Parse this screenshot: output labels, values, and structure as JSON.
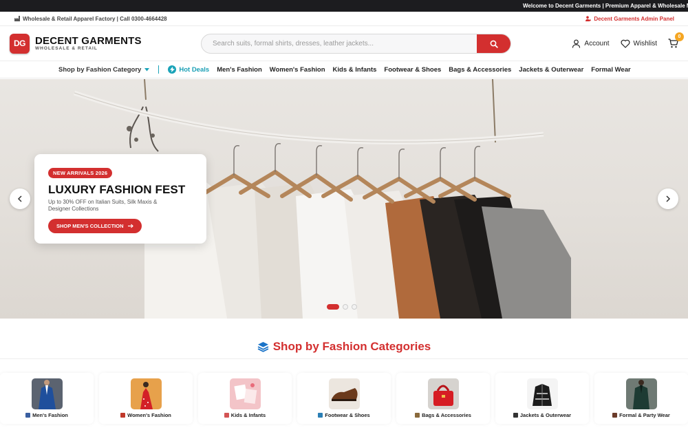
{
  "ticker": {
    "text": "Welcome to Decent Garments | Premium Apparel & Wholesale Ma"
  },
  "infobar": {
    "left_text": "Wholesale & Retail Apparel Factory | Call 0300-4664428",
    "right_text": "Decent Garments Admin Panel"
  },
  "header": {
    "logo_mark": "DG",
    "brand": "DECENT GARMENTS",
    "tagline": "WHOLESALE & RETAIL",
    "search_placeholder": "Search suits, formal shirts, dresses, leather jackets...",
    "account_label": "Account",
    "wishlist_label": "Wishlist",
    "cart_count": "0"
  },
  "nav": {
    "category_dropdown": "Shop by Fashion Category",
    "hot_deals": "Hot Deals",
    "items": [
      "Men's Fashion",
      "Women's Fashion",
      "Kids & Infants",
      "Footwear & Shoes",
      "Bags & Accessories",
      "Jackets & Outerwear",
      "Formal Wear"
    ]
  },
  "hero": {
    "badge": "NEW ARRIVALS 2026",
    "title": "LUXURY FASHION FEST",
    "description": "Up to 30% OFF on Italian Suits, Silk Maxis & Designer Collections",
    "cta": "SHOP MEN'S COLLECTION",
    "slide_count": 3,
    "active_slide": 1
  },
  "section": {
    "title": "Shop by Fashion Categories"
  },
  "categories": [
    {
      "label": "Men's Fashion",
      "icon": "shirt-icon",
      "color": "#3a5fa0"
    },
    {
      "label": "Women's Fashion",
      "icon": "dress-icon",
      "color": "#c0392b"
    },
    {
      "label": "Kids & Infants",
      "icon": "baby-icon",
      "color": "#d35454"
    },
    {
      "label": "Footwear & Shoes",
      "icon": "shoe-icon",
      "color": "#2b7fb5"
    },
    {
      "label": "Bags & Accessories",
      "icon": "bag-icon",
      "color": "#8a6a3c"
    },
    {
      "label": "Jackets & Outerwear",
      "icon": "jacket-icon",
      "color": "#333333"
    },
    {
      "label": "Formal & Party Wear",
      "icon": "suit-icon",
      "color": "#6b3b2a"
    }
  ],
  "colors": {
    "brand_red": "#d32f2f",
    "accent_teal": "#1aa3b8",
    "badge_orange": "#f5a623"
  }
}
